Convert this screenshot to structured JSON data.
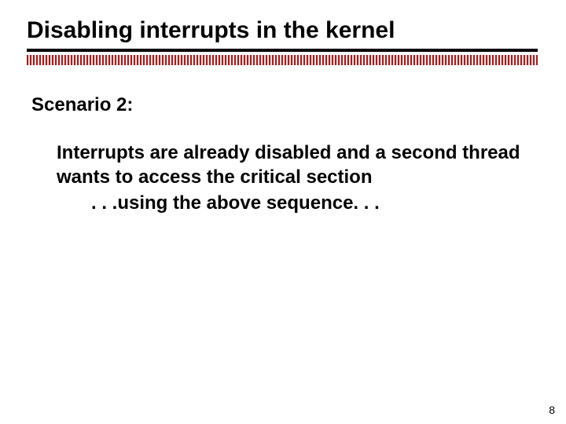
{
  "title": "Disabling interrupts in the kernel",
  "subtitle": "Scenario 2:",
  "body": {
    "line1": "Interrupts are already disabled and a second thread wants to access the critical section",
    "line2": ". . .using the above sequence. . ."
  },
  "page_number": "8"
}
